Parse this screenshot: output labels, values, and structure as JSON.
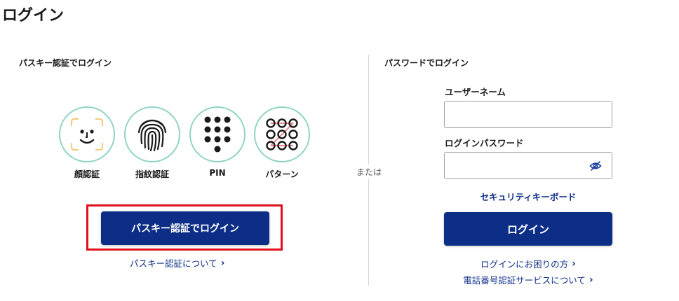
{
  "page": {
    "title": "ログイン"
  },
  "passkey": {
    "section_title": "パスキー認証でログイン",
    "methods": [
      {
        "label": "顔認証",
        "icon": "face-recognition-icon"
      },
      {
        "label": "指紋認証",
        "icon": "fingerprint-icon"
      },
      {
        "label": "PIN",
        "icon": "pin-keypad-icon"
      },
      {
        "label": "パターン",
        "icon": "pattern-lock-icon"
      }
    ],
    "button_label": "パスキー認証でログイン",
    "about_link": "パスキー認証について"
  },
  "separator": {
    "label": "または"
  },
  "password": {
    "section_title": "パスワードでログイン",
    "username_label": "ユーザーネーム",
    "username_value": "",
    "password_label": "ログインパスワード",
    "password_value": "",
    "security_keyboard_link": "セキュリティキーボード",
    "login_button": "ログイン",
    "trouble_link": "ログインにお困りの方",
    "sms_link": "電話番号認証サービスについて"
  },
  "colors": {
    "primary": "#0c2e86",
    "circle_border": "#8fd3c4",
    "highlight": "#e0101a",
    "face_frame": "#f2c879"
  }
}
